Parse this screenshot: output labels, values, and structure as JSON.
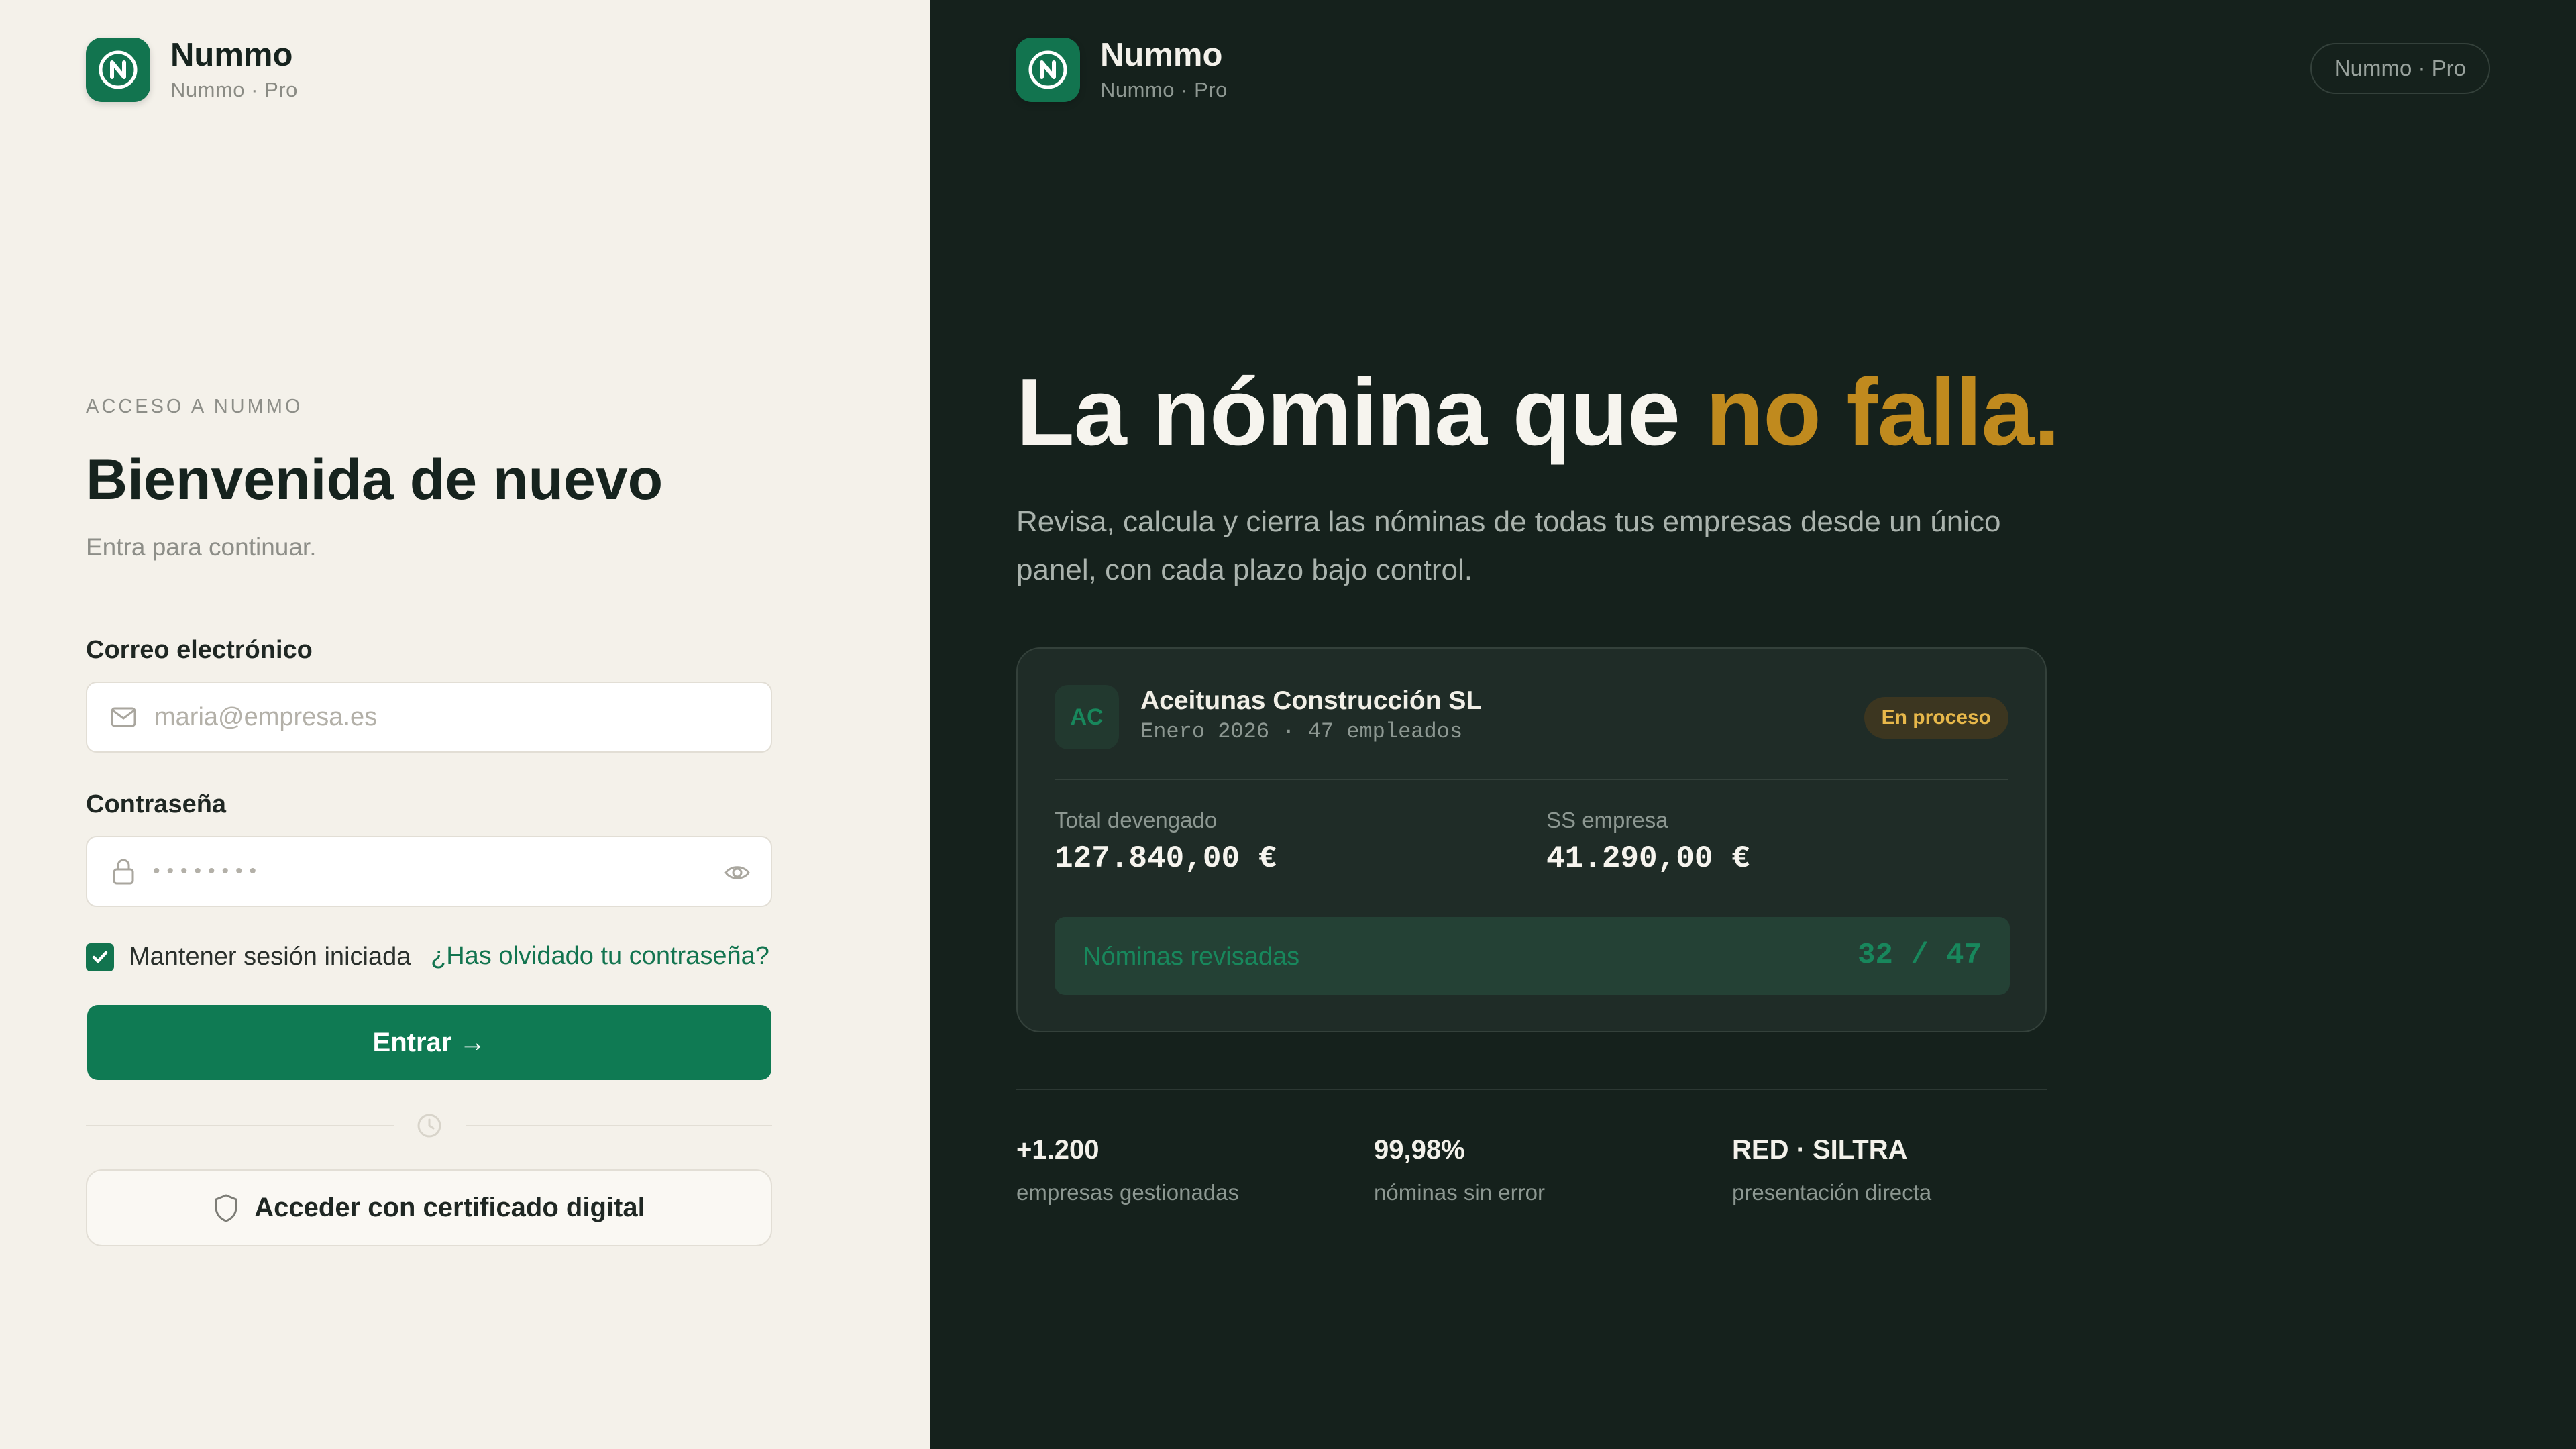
{
  "brand": {
    "name": "Nummo",
    "subtitle": "Nummo · Pro",
    "logo_letter": "N"
  },
  "login": {
    "eyebrow": "ACCESO A NUMMO",
    "title": "Bienvenida de nuevo",
    "subtitle": "Entra para continuar.",
    "email": {
      "label": "Correo electrónico",
      "placeholder": "maria@empresa.es",
      "value": ""
    },
    "password": {
      "label": "Contraseña",
      "masked_value": "••••••••"
    },
    "remember": {
      "label": "Mantener sesión iniciada",
      "checked": true
    },
    "forgot_link": "¿Has olvidado tu contraseña?",
    "submit_label": "Entrar →",
    "certificate_label": "Acceder con certificado digital"
  },
  "promo": {
    "plan_pill": "Nummo · Pro",
    "headline": {
      "main": "La nómina que ",
      "accent": "no falla."
    },
    "description": "Revisa, calcula y cierra las nóminas de todas tus empresas desde un único panel, con cada plazo bajo control.",
    "card": {
      "initials": "AC",
      "company": "Aceitunas Construcción SL",
      "meta": "Enero 2026 · 47 empleados",
      "status": "En proceso",
      "metrics": [
        {
          "label": "Total devengado",
          "value": "127.840,00 €"
        },
        {
          "label": "SS empresa",
          "value": "41.290,00 €"
        }
      ],
      "progress": {
        "label": "Nóminas revisadas",
        "count": "32 / 47",
        "done": 32,
        "total": 47
      }
    },
    "stats": [
      {
        "value": "+1.200",
        "label": "empresas gestionadas"
      },
      {
        "value": "99,98%",
        "label": "nóminas sin error"
      },
      {
        "value": "RED · SILTRA",
        "label": "presentación directa"
      }
    ]
  },
  "colors": {
    "accent_green": "#12744f",
    "gold": "#c08a1e",
    "dark_bg": "#15211c",
    "light_bg": "#f4f1ea"
  },
  "icons": [
    "logo-n-icon",
    "mail-icon",
    "lock-icon",
    "eye-icon",
    "check-icon",
    "clock-icon",
    "shield-icon"
  ]
}
